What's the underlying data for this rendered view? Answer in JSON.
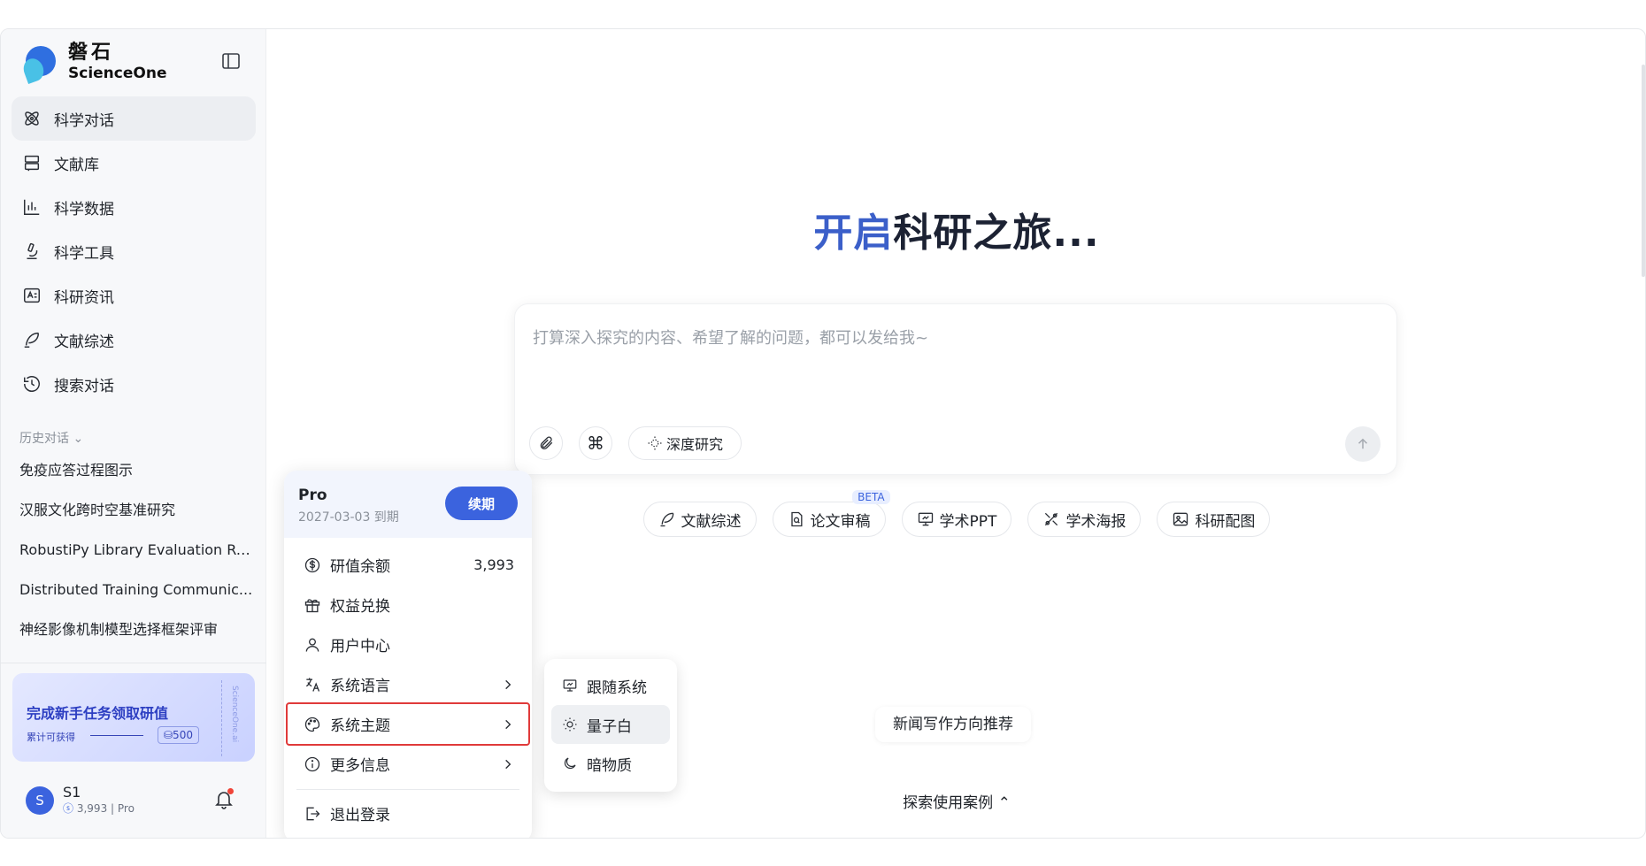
{
  "brand": {
    "name_cn": "磐石",
    "name_en": "ScienceOne"
  },
  "nav": [
    {
      "label": "科学对话",
      "icon": "atom-icon",
      "active": true
    },
    {
      "label": "文献库",
      "icon": "library-icon"
    },
    {
      "label": "科学数据",
      "icon": "data-chart-icon"
    },
    {
      "label": "科学工具",
      "icon": "microscope-icon"
    },
    {
      "label": "科研资讯",
      "icon": "news-icon"
    },
    {
      "label": "文献综述",
      "icon": "quill-icon"
    },
    {
      "label": "搜索对话",
      "icon": "history-icon"
    }
  ],
  "history": {
    "title": "历史对话",
    "items": [
      "免疫应答过程图示",
      "汉服文化跨时空基准研究",
      "RobustiPy Library Evaluation Re...",
      "Distributed Training Communic...",
      "神经影像机制模型选择框架评审"
    ]
  },
  "promo": {
    "title": "完成新手任务领取研值",
    "subtitle": "累计可获得",
    "amount": "⛁500",
    "vertical": "ScienceOne.ai"
  },
  "user": {
    "avatar": "S",
    "name": "S1",
    "balance": "3,993",
    "plan": "Pro"
  },
  "hero": {
    "part1": "开启",
    "part2": "科研之旅..."
  },
  "composer": {
    "placeholder": "打算深入探究的内容、希望了解的问题，都可以发给我~",
    "deep_research": "深度研究"
  },
  "chips": [
    {
      "label": "文献综述",
      "icon": "quill-icon"
    },
    {
      "label": "论文审稿",
      "icon": "doc-search-icon",
      "badge": "BETA"
    },
    {
      "label": "学术PPT",
      "icon": "presentation-icon"
    },
    {
      "label": "学术海报",
      "icon": "poster-icon"
    },
    {
      "label": "科研配图",
      "icon": "image-icon"
    }
  ],
  "recommend": "新闻写作方向推荐",
  "explore": "探索使用案例",
  "account_menu": {
    "plan": "Pro",
    "expiry": "2027-03-03 到期",
    "renew": "续期",
    "items": [
      {
        "label": "研值余额",
        "value": "3,993",
        "icon": "coin-icon"
      },
      {
        "label": "权益兑换",
        "icon": "gift-icon"
      },
      {
        "label": "用户中心",
        "icon": "user-icon"
      },
      {
        "label": "系统语言",
        "icon": "translate-icon",
        "submenu": true
      },
      {
        "label": "系统主题",
        "icon": "palette-icon",
        "submenu": true,
        "highlighted": true
      },
      {
        "label": "更多信息",
        "icon": "info-icon",
        "submenu": true
      }
    ],
    "logout": "退出登录"
  },
  "theme_menu": [
    {
      "label": "跟随系统",
      "icon": "monitor-icon"
    },
    {
      "label": "量子白",
      "icon": "sun-icon",
      "selected": true
    },
    {
      "label": "暗物质",
      "icon": "moon-icon"
    }
  ]
}
